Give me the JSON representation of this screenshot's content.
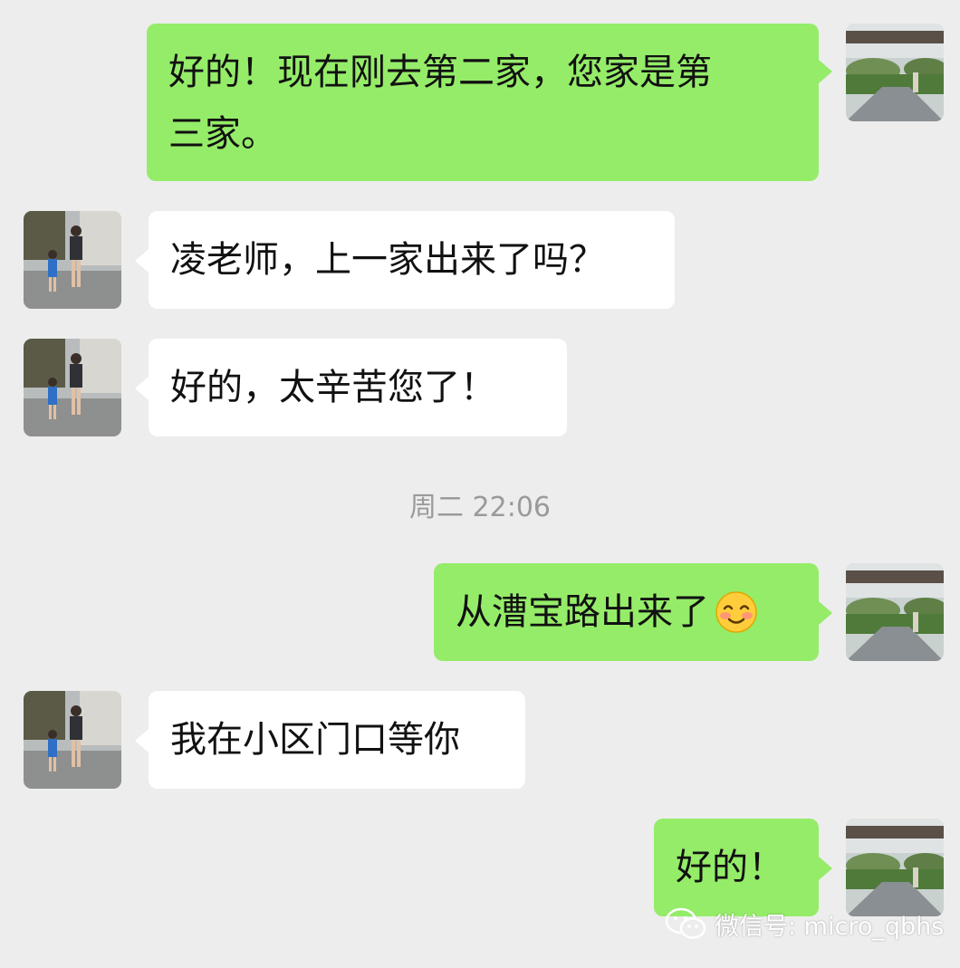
{
  "messages": [
    {
      "id": "m1",
      "side": "right",
      "text": "好的！现在刚去第二家，您家是第三家。",
      "lines": [
        "好的！现在刚去第二家，您家是第",
        "三家。"
      ]
    },
    {
      "id": "m2",
      "side": "left",
      "text": "凌老师，上一家出来了吗？"
    },
    {
      "id": "m3",
      "side": "left",
      "text": "好的，太辛苦您了！"
    },
    {
      "id": "m4",
      "side": "right",
      "text": "从漕宝路出来了",
      "emoji": "smiling-blush-emoji"
    },
    {
      "id": "m5",
      "side": "left",
      "text": "我在小区门口等你"
    },
    {
      "id": "m6",
      "side": "right",
      "text": "好的！"
    }
  ],
  "timestamp": "周二 22:06",
  "watermark": {
    "icon": "wechat-icon",
    "text": "微信号: micro_qbhs"
  },
  "colors": {
    "background": "#ededed",
    "own_bubble": "#95ec69",
    "other_bubble": "#ffffff",
    "timestamp": "#9a9a9a"
  },
  "avatars": {
    "self": "landscape-photo-avatar",
    "contact": "family-walking-photo-avatar"
  }
}
